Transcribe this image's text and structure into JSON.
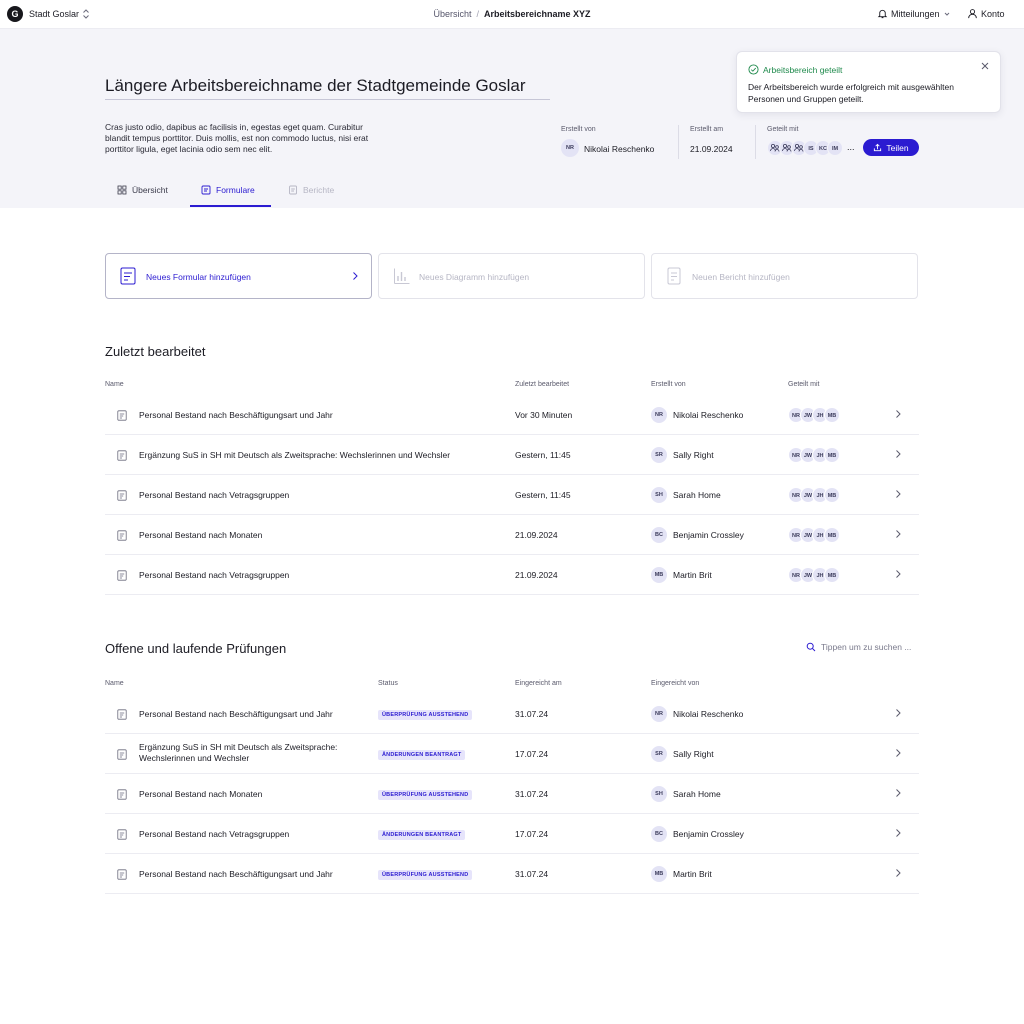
{
  "topbar": {
    "logo_letter": "G",
    "org_name": "Stadt Goslar",
    "breadcrumb": [
      "Übersicht",
      "Arbeitsbereichname XYZ"
    ],
    "breadcrumb_sep": "/",
    "notifications_label": "Mitteilungen",
    "account_label": "Konto"
  },
  "hero": {
    "title": "Längere Arbeitsbereichname der Stadtgemeinde Goslar",
    "description": "Cras justo odio, dapibus ac facilisis in, egestas eget quam. Curabitur blandit tempus porttitor. Duis mollis, est non commodo luctus, nisi erat porttitor ligula, eget lacinia odio sem nec elit.",
    "created_by_label": "Erstellt von",
    "created_by_initials": "NR",
    "created_by_name": "Nikolai Reschenko",
    "created_at_label": "Erstellt am",
    "created_at_value": "21.09.2024",
    "shared_with_label": "Geteilt mit",
    "shared_avatars": [
      "group",
      "group",
      "group",
      "IS",
      "KC",
      "IM"
    ],
    "shared_more": "...",
    "share_button": "Teilen"
  },
  "tabs": [
    {
      "label": "Übersicht",
      "icon": "grid-icon",
      "state": "default"
    },
    {
      "label": "Formulare",
      "icon": "form-icon",
      "state": "active"
    },
    {
      "label": "Berichte",
      "icon": "report-icon",
      "state": "disabled"
    }
  ],
  "toast": {
    "title": "Arbeitsbereich geteilt",
    "body": "Der Arbeitsbereich wurde erfolgreich mit ausgewählten Personen und Gruppen geteilt."
  },
  "actions": [
    {
      "label": "Neues Formular hinzufügen",
      "state": "enabled"
    },
    {
      "label": "Neues Diagramm hinzufügen",
      "state": "disabled"
    },
    {
      "label": "Neuen Bericht hinzufügen",
      "state": "disabled"
    }
  ],
  "recent": {
    "title": "Zuletzt bearbeitet",
    "columns": [
      "Name",
      "Zuletzt bearbeitet",
      "Erstellt von",
      "Geteilt mit"
    ],
    "rows": [
      {
        "name": "Personal Bestand nach Beschäftigungsart und Jahr",
        "edited": "Vor 30 Minuten",
        "initials": "NR",
        "creator": "Nikolai Reschenko",
        "shared": [
          "NR",
          "JW",
          "JH",
          "MB"
        ]
      },
      {
        "name": "Ergänzung SuS in SH mit Deutsch als Zweitsprache: Wechslerinnen und Wechsler",
        "edited": "Gestern, 11:45",
        "initials": "SR",
        "creator": "Sally Right",
        "shared": [
          "NR",
          "JW",
          "JH",
          "MB"
        ]
      },
      {
        "name": "Personal Bestand nach Vetragsgruppen",
        "edited": "Gestern, 11:45",
        "initials": "SH",
        "creator": "Sarah Home",
        "shared": [
          "NR",
          "JW",
          "JH",
          "MB"
        ]
      },
      {
        "name": "Personal Bestand nach Monaten",
        "edited": "21.09.2024",
        "initials": "BC",
        "creator": "Benjamin Crossley",
        "shared": [
          "NR",
          "JW",
          "JH",
          "MB"
        ]
      },
      {
        "name": "Personal Bestand nach Vetragsgruppen",
        "edited": "21.09.2024",
        "initials": "MB",
        "creator": "Martin Brit",
        "shared": [
          "NR",
          "JW",
          "JH",
          "MB"
        ]
      }
    ]
  },
  "reviews": {
    "title": "Offene und laufende Prüfungen",
    "search_placeholder": "Tippen um zu suchen ...",
    "columns": [
      "Name",
      "Status",
      "Eingereicht am",
      "Eingereicht von"
    ],
    "rows": [
      {
        "name": "Personal Bestand nach Beschäftigungsart und Jahr",
        "status": "ÜBERPRÜFUNG AUSSTEHEND",
        "date": "31.07.24",
        "initials": "NR",
        "submitter": "Nikolai Reschenko"
      },
      {
        "name": "Ergänzung SuS in SH mit Deutsch als Zweitsprache: Wechslerinnen und Wechsler",
        "status": "ÄNDERUNGEN BEANTRAGT",
        "date": "17.07.24",
        "initials": "SR",
        "submitter": "Sally Right"
      },
      {
        "name": "Personal Bestand nach Monaten",
        "status": "ÜBERPRÜFUNG AUSSTEHEND",
        "date": "31.07.24",
        "initials": "SH",
        "submitter": "Sarah Home"
      },
      {
        "name": "Personal Bestand nach Vetragsgruppen",
        "status": "ÄNDERUNGEN BEANTRAGT",
        "date": "17.07.24",
        "initials": "BC",
        "submitter": "Benjamin Crossley"
      },
      {
        "name": "Personal Bestand nach Beschäftigungsart und Jahr",
        "status": "ÜBERPRÜFUNG AUSSTEHEND",
        "date": "31.07.24",
        "initials": "MB",
        "submitter": "Martin Brit"
      }
    ]
  },
  "colors": {
    "accent": "#2b1bd1",
    "success": "#1f8a4c",
    "hero_bg": "#f4f4f9",
    "badge_bg": "#e6e4fb"
  }
}
